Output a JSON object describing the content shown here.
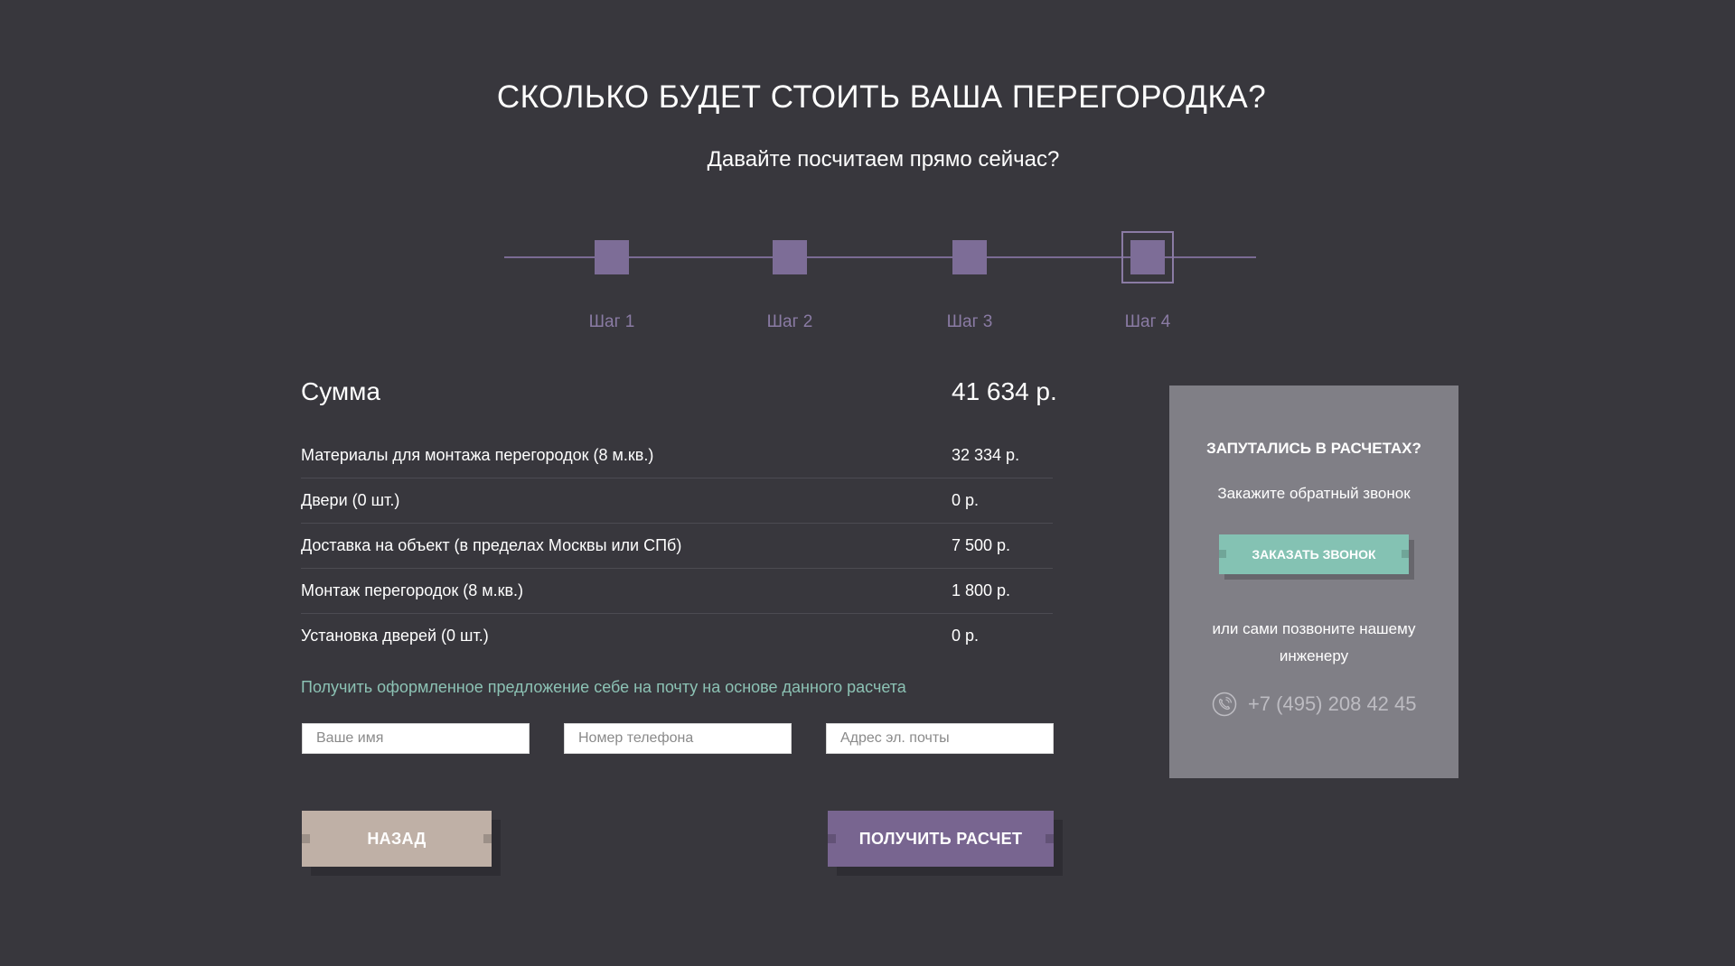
{
  "header": {
    "title": "СКОЛЬКО БУДЕТ СТОИТЬ ВАША ПЕРЕГОРОДКА?",
    "subtitle": "Давайте посчитаем прямо сейчас?"
  },
  "stepper": {
    "steps": [
      {
        "label": "Шаг 1",
        "active": false
      },
      {
        "label": "Шаг 2",
        "active": false
      },
      {
        "label": "Шаг 3",
        "active": false
      },
      {
        "label": "Шаг 4",
        "active": true
      }
    ]
  },
  "summary": {
    "total_label": "Сумма",
    "total_value": "41 634 р.",
    "items": [
      {
        "label": "Материалы для монтажа перегородок (8 м.кв.)",
        "value": "32 334 р."
      },
      {
        "label": "Двери (0 шт.)",
        "value": "0 р."
      },
      {
        "label": "Доставка на объект (в пределах Москвы или СПб)",
        "value": "7 500 р."
      },
      {
        "label": "Монтаж перегородок (8 м.кв.)",
        "value": "1 800 р."
      },
      {
        "label": "Установка дверей (0 шт.)",
        "value": "0 р."
      }
    ]
  },
  "form": {
    "offer_text": "Получить оформленное предложение себе на почту на основе данного расчета",
    "name_placeholder": "Ваше имя",
    "phone_placeholder": "Номер телефона",
    "email_placeholder": "Адрес эл. почты",
    "back_label": "НАЗАД",
    "submit_label": "ПОЛУЧИТЬ РАСЧЕТ"
  },
  "help": {
    "title": "ЗАПУТАЛИСЬ В РАСЧЕТАХ?",
    "subtitle": "Закажите обратный звонок",
    "callback_label": "ЗАКАЗАТЬ ЗВОНОК",
    "or_text": "или сами позвоните нашему инженеру",
    "phone": "+7 (495) 208 42 45",
    "phone_icon": "phone-icon"
  },
  "colors": {
    "background": "#38373d",
    "accent_purple": "#7d6d97",
    "accent_teal": "#84c2b3",
    "back_button": "#bfb0a6",
    "panel": "#807f86"
  }
}
